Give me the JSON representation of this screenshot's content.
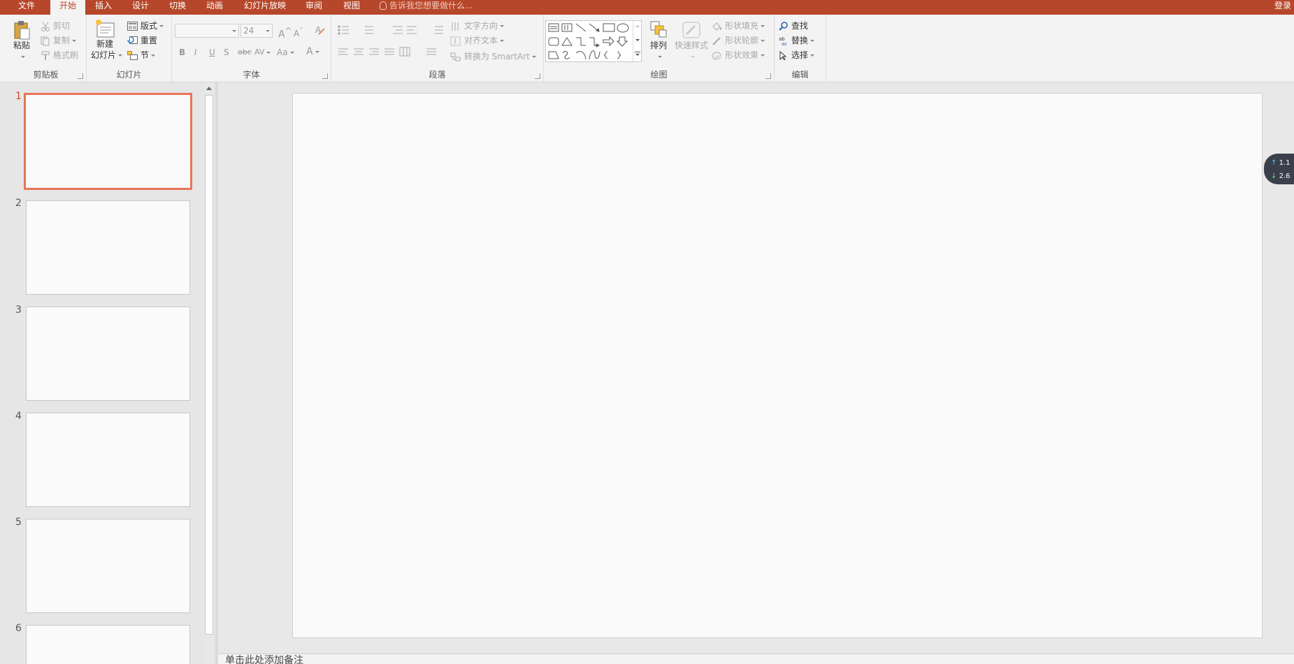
{
  "tabs": [
    "文件",
    "开始",
    "插入",
    "设计",
    "切换",
    "动画",
    "幻灯片放映",
    "审阅",
    "视图"
  ],
  "active_tab": "开始",
  "tell_me": "告诉我您想要做什么...",
  "login": "登录",
  "clipboard": {
    "paste": "粘贴",
    "cut": "剪切",
    "copy": "复制",
    "format_painter": "格式刷",
    "label": "剪贴板"
  },
  "slides_group": {
    "new_slide_1": "新建",
    "new_slide_2": "幻灯片",
    "layout": "版式",
    "reset": "重置",
    "section": "节",
    "label": "幻灯片"
  },
  "font": {
    "font_size": "24",
    "bold": "B",
    "italic": "I",
    "underline": "U",
    "shadow": "S",
    "strike": "abc",
    "spacing": "AV",
    "case": "Aa",
    "grow": "A",
    "shrink": "A",
    "color": "A",
    "label": "字体"
  },
  "paragraph": {
    "text_direction": "文字方向",
    "align_text": "对齐文本",
    "smartart": "转换为 SmartArt",
    "label": "段落"
  },
  "drawing": {
    "arrange": "排列",
    "quick_styles": "快速样式",
    "shape_fill": "形状填充",
    "shape_outline": "形状轮廓",
    "shape_effects": "形状效果",
    "label": "绘图"
  },
  "editing": {
    "find": "查找",
    "replace": "替换",
    "select": "选择",
    "label": "编辑"
  },
  "slide_numbers": [
    "1",
    "2",
    "3",
    "4",
    "5",
    "6"
  ],
  "notes_placeholder": "单击此处添加备注",
  "net": {
    "up": "1.1",
    "down": "2.6"
  },
  "colors": {
    "accent": "#b7472a",
    "selection": "#e8755a"
  }
}
